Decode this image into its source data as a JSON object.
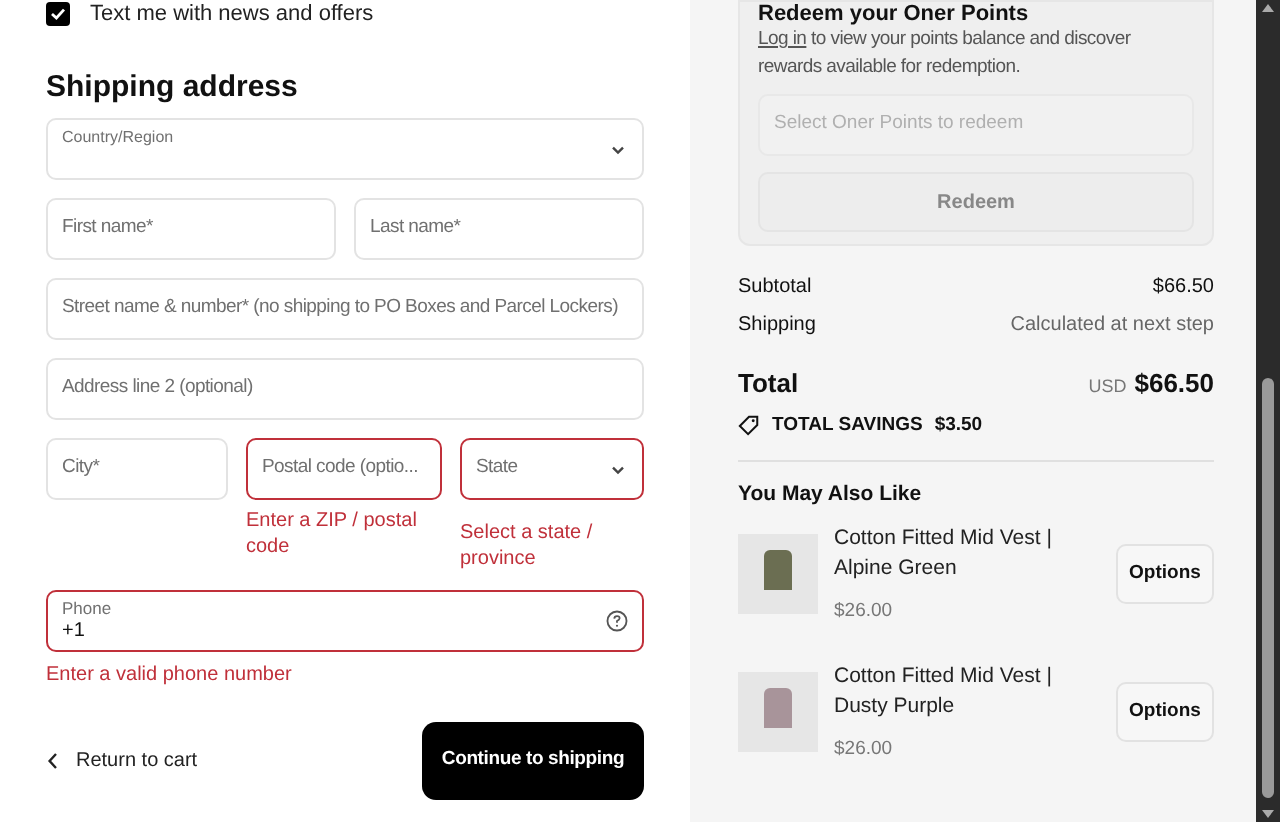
{
  "marketing_sms": {
    "label": "Text me with news and offers",
    "checked": true
  },
  "shipping_address": {
    "title": "Shipping address",
    "rows": [
      [
        {
          "kind": "labeled_select",
          "placeholder": "Country/Region",
          "error": false
        }
      ],
      [
        {
          "kind": "input",
          "placeholder": "First name*",
          "error": false
        },
        {
          "kind": "input",
          "placeholder": "Last name*",
          "error": false
        }
      ],
      [
        {
          "kind": "input",
          "placeholder": "Street name & number* (no shipping to PO Boxes and Parcel Lockers)",
          "error": false
        }
      ],
      [
        {
          "kind": "input",
          "placeholder": "Address line 2 (optional)",
          "error": false
        }
      ],
      [
        {
          "kind": "input",
          "placeholder": "City*",
          "error": false
        },
        {
          "kind": "input",
          "placeholder": "Postal code (optio...",
          "error": true,
          "message": "Enter a ZIP / postal code"
        },
        {
          "kind": "select",
          "placeholder": "State",
          "error": true,
          "message": "Select a state / province"
        }
      ],
      [
        {
          "kind": "phone",
          "label": "Phone",
          "value": "+1",
          "error": true,
          "message": "Enter a valid phone number"
        }
      ]
    ]
  },
  "return_link": {
    "label": "Return to cart"
  },
  "continue_button": {
    "label": "Continue to shipping"
  },
  "points": {
    "title": "Redeem your Oner Points",
    "login_link": "Log in",
    "text": "to view your points balance and discover rewards available for redemption.",
    "select_placeholder": "Select Oner Points to redeem",
    "button": "Redeem"
  },
  "summary": [
    {
      "label": "Subtotal",
      "value": "$66.50"
    },
    {
      "label": "Shipping",
      "value": "Calculated at next step"
    }
  ],
  "total": {
    "label": "Total",
    "currency": "USD",
    "value": "$66.50"
  },
  "savings": {
    "label": "TOTAL SAVINGS",
    "value": "$3.50"
  },
  "recommendations": {
    "title": "You May Also Like",
    "items": [
      {
        "name": "Cotton Fitted Mid Vest | Alpine Green",
        "price": "$26.00",
        "button": "Options",
        "color": "#6b6e52"
      },
      {
        "name": "Cotton Fitted Mid Vest | Dusty Purple",
        "price": "$26.00",
        "button": "Options",
        "color": "#a8949a"
      }
    ]
  }
}
